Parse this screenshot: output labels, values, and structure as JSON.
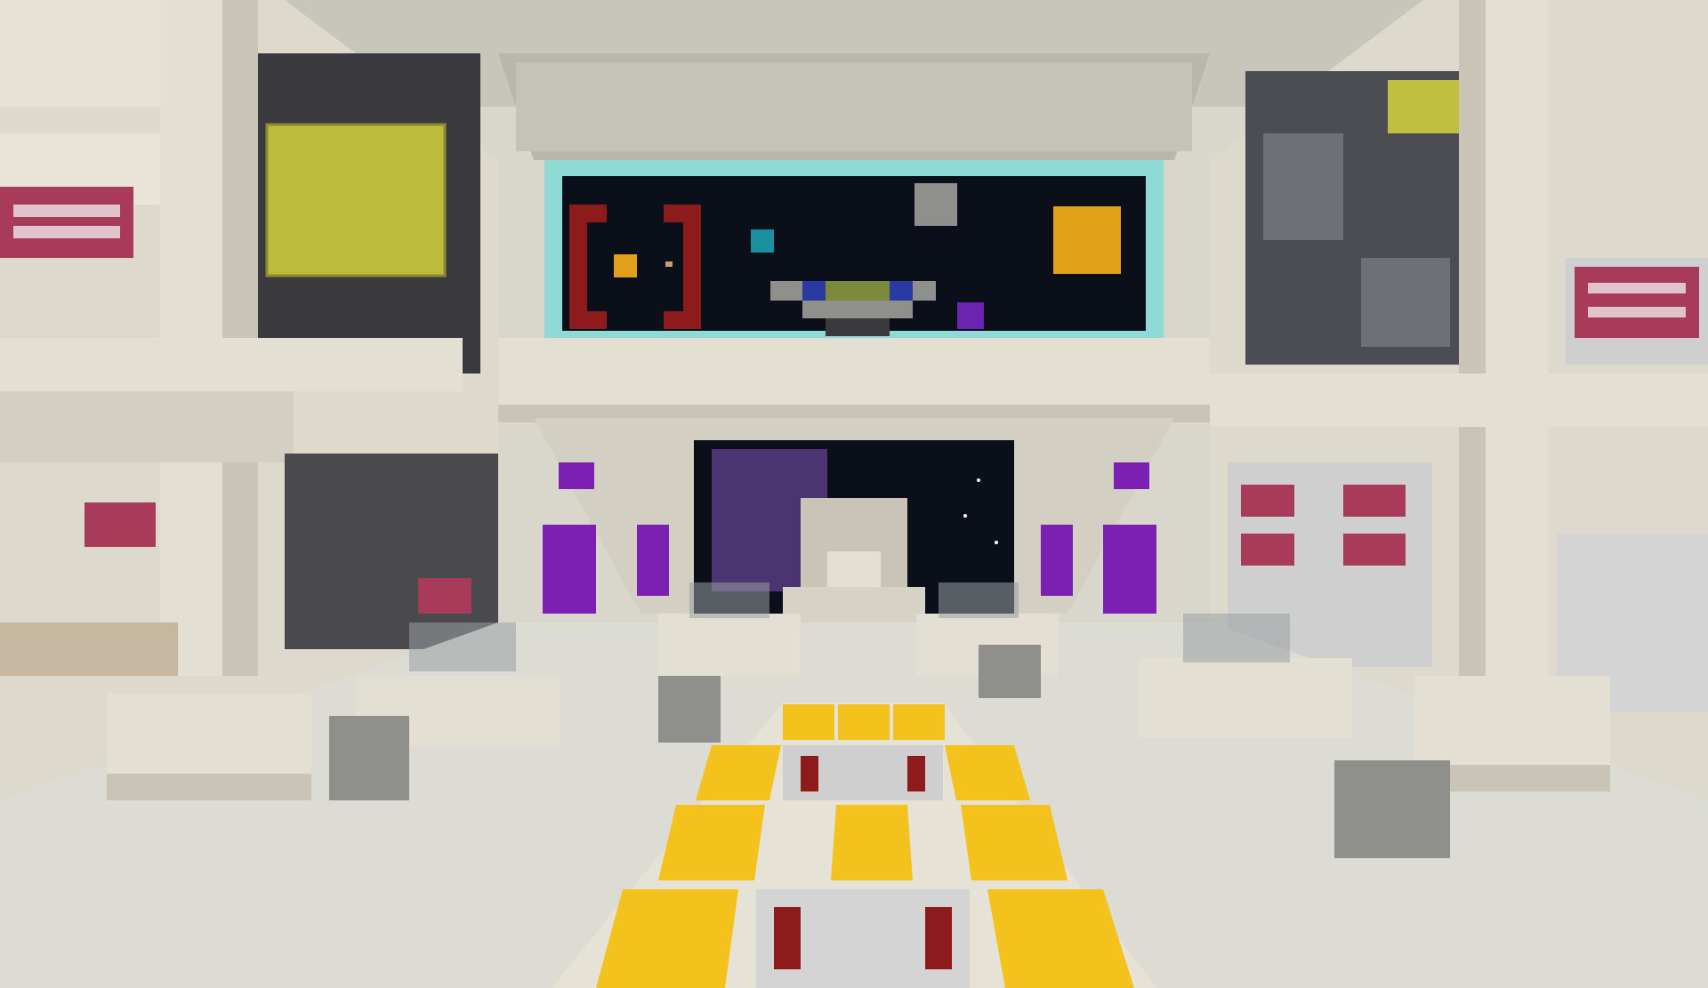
{
  "scene": {
    "description_free": true,
    "colors": {
      "quartz": "#e3dfd3",
      "quartz_shade": "#c9c4b6",
      "quartz_dark": "#b2ad9f",
      "floor": "#dcdcd5",
      "ceiling": "#bfbdb4",
      "gold": "#f3c21c",
      "gold_edge": "#c99a0c",
      "void": "#0b0f1a",
      "beacon_glass": "#8fd9d6",
      "redstone_red": "#8e1b1b",
      "purple": "#7c1fb3",
      "magenta_panel": "#a83a5a",
      "yellow_glass": "#e6e34a",
      "stone_gray": "#8f8f8c",
      "dark_block": "#3a3a3e",
      "glass_pane": "#9aa0a2"
    },
    "screen_pixels": {
      "bracket_color": "#8e1b1b",
      "orange_square": "#e0a01a",
      "cyan_square": "#1a8fa0",
      "gray_square": "#8f8f8c",
      "purple_square": "#6a24b0",
      "green_bar": "#7a8a3a",
      "blue_dots": "#2a3aa0"
    }
  }
}
